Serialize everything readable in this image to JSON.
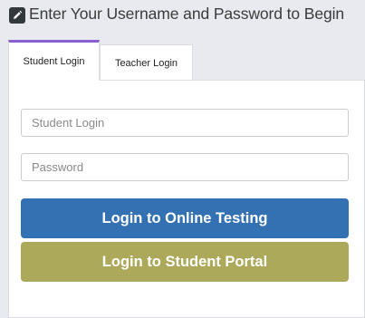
{
  "header": {
    "icon": "edit-icon",
    "title": "Enter Your Username and Password to Begin"
  },
  "tabs": [
    {
      "label": "Student Login",
      "active": true
    },
    {
      "label": "Teacher Login",
      "active": false
    }
  ],
  "form": {
    "username_placeholder": "Student Login",
    "password_placeholder": "Password"
  },
  "buttons": {
    "testing_label": "Login to Online Testing",
    "portal_label": "Login to Student Portal"
  },
  "colors": {
    "active_tab_accent": "#8a60d0",
    "testing_button": "#3471b3",
    "portal_button": "#aca95b"
  }
}
